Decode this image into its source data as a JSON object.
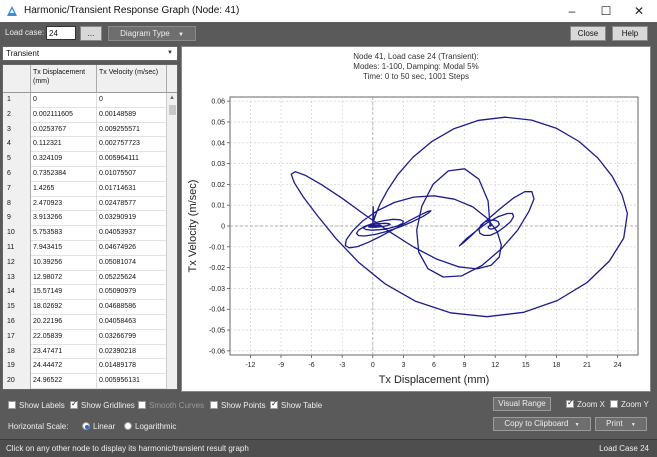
{
  "window": {
    "title": "Harmonic/Transient Response Graph (Node: 41)"
  },
  "toolbar": {
    "load_case_label": "Load case:",
    "load_case_value": "24",
    "ellipsis_label": "...",
    "diagram_type_label": "Diagram Type",
    "close_label": "Close",
    "help_label": "Help"
  },
  "left": {
    "mode_select": "Transient",
    "columns": [
      "Tx Displacement (mm)",
      "Tx Velocity (m/sec)"
    ],
    "rows": [
      [
        "1",
        "0",
        "0"
      ],
      [
        "2",
        "0.002111605",
        "0.00148589"
      ],
      [
        "3",
        "0.0253767",
        "0.009255571"
      ],
      [
        "4",
        "0.112321",
        "0.002757723"
      ],
      [
        "5",
        "0.324109",
        "0.005964111"
      ],
      [
        "6",
        "0.7352384",
        "0.01075507"
      ],
      [
        "7",
        "1.4265",
        "0.01714631"
      ],
      [
        "8",
        "2.470923",
        "0.02478577"
      ],
      [
        "9",
        "3.913266",
        "0.03290919"
      ],
      [
        "10",
        "5.753583",
        "0.04053937"
      ],
      [
        "11",
        "7.943415",
        "0.04674926"
      ],
      [
        "12",
        "10.39256",
        "0.05081074"
      ],
      [
        "13",
        "12.98072",
        "0.05225624"
      ],
      [
        "14",
        "15.57149",
        "0.05090979"
      ],
      [
        "15",
        "18.02692",
        "0.04688586"
      ],
      [
        "16",
        "20.22196",
        "0.04058463"
      ],
      [
        "17",
        "22.05839",
        "0.03266799"
      ],
      [
        "18",
        "23.47471",
        "0.02390218"
      ],
      [
        "19",
        "24.44472",
        "0.01489178"
      ],
      [
        "20",
        "24.96522",
        "0.005956131"
      ]
    ]
  },
  "chart_data": {
    "type": "line",
    "title_lines": [
      "Node 41, Load case 24 (Transient):",
      "Modes: 1-100, Damping: Modal 5%",
      "Time: 0 to 50 sec, 1001 Steps"
    ],
    "xlabel": "Tx Displacement (mm)",
    "ylabel": "Tx Velocity (m/sec)",
    "xlim": [
      -14,
      26
    ],
    "ylim": [
      -0.062,
      0.062
    ],
    "xticks": [
      -12,
      -9,
      -6,
      -3,
      0,
      3,
      6,
      9,
      12,
      15,
      18,
      21,
      24
    ],
    "yticks": [
      -0.06,
      -0.05,
      -0.04,
      -0.03,
      -0.02,
      -0.01,
      0,
      0.01,
      0.02,
      0.03,
      0.04,
      0.05,
      0.06
    ],
    "grid": true,
    "series": [
      {
        "color": "#1c1c8c",
        "x": [
          0,
          0.002,
          0.025,
          0.112,
          0.324,
          0.735,
          1.427,
          2.471,
          3.913,
          5.754,
          7.943,
          10.393,
          12.981,
          15.571,
          18.027,
          20.222,
          22.058,
          23.475,
          24.445,
          24.965,
          24.6,
          23.2,
          21.0,
          18.1,
          14.8,
          11.2,
          7.6,
          4.2,
          1.2,
          -1.4,
          -3.6,
          -5.4,
          -6.8,
          -7.7,
          -8.0,
          -7.6,
          -6.6,
          -5.0,
          -3.0,
          -0.8,
          1.6,
          4.0,
          6.3,
          8.4,
          10.2,
          11.6,
          12.4,
          12.6,
          12.2,
          11.2,
          9.8,
          8.0,
          6.0,
          4.0,
          2.1,
          0.4,
          -1.0,
          -2.0,
          -2.6,
          -2.7,
          -2.3,
          -1.5,
          -0.4,
          0.9,
          2.3,
          3.6,
          4.7,
          5.4,
          5.7,
          5.5,
          4.9,
          3.9,
          2.7,
          1.4,
          0.2,
          -0.8,
          -1.4,
          -1.6,
          -1.4,
          -0.8,
          0.1,
          1.1,
          2.0,
          2.7,
          3.0,
          2.9,
          2.4,
          1.6,
          0.7,
          -0.1,
          -0.7,
          -0.9,
          -0.7,
          -0.2,
          0.5,
          1.2,
          1.6,
          1.7,
          1.4,
          0.9,
          0.3,
          -0.2,
          -0.4,
          -0.3,
          0.1,
          0.5,
          0.8,
          0.8,
          0.5,
          0.2,
          0.0
        ],
        "y": [
          0,
          0.0015,
          0.0093,
          0.0028,
          0.006,
          0.0108,
          0.0171,
          0.0248,
          0.0329,
          0.0405,
          0.0467,
          0.0508,
          0.0523,
          0.0509,
          0.0469,
          0.0406,
          0.0327,
          0.0239,
          0.0149,
          0.006,
          -0.0058,
          -0.0168,
          -0.0272,
          -0.0358,
          -0.0415,
          -0.0436,
          -0.0417,
          -0.0362,
          -0.0278,
          -0.0174,
          -0.0061,
          0.0048,
          0.0139,
          0.0208,
          0.0249,
          0.0261,
          0.0243,
          0.0198,
          0.0133,
          0.0055,
          -0.0026,
          -0.0101,
          -0.016,
          -0.0196,
          -0.0206,
          -0.0189,
          -0.0149,
          -0.0092,
          -0.0027,
          0.0038,
          0.0092,
          0.0129,
          0.0145,
          0.0139,
          0.0113,
          0.0072,
          0.0024,
          -0.0025,
          -0.0066,
          -0.0094,
          -0.0105,
          -0.0099,
          -0.0078,
          -0.0046,
          -0.0009,
          0.0026,
          0.0054,
          0.007,
          0.0073,
          0.0064,
          0.0045,
          0.0021,
          -0.0004,
          -0.0026,
          -0.0041,
          -0.0048,
          -0.0046,
          -0.0035,
          -0.002,
          -0.0002,
          0.0014,
          0.0026,
          0.0032,
          0.003,
          0.0023,
          0.0012,
          0.0,
          -0.0011,
          -0.0018,
          -0.002,
          -0.0017,
          -0.001,
          -0.0002,
          0.0006,
          0.0011,
          0.0013,
          0.0011,
          0.0007,
          0.0002,
          -0.0003,
          -0.0006,
          -0.0006,
          -0.0004,
          -0.0001,
          0.0002,
          0.0003,
          0.0003,
          0.0001,
          0.0,
          0.0,
          0.0
        ]
      },
      {
        "color": "#1c1c8c",
        "x": [
          11.5,
          11.3,
          10.4,
          9.0,
          7.4,
          5.9,
          4.8,
          4.3,
          4.5,
          5.4,
          6.9,
          8.7,
          10.7,
          12.6,
          14.2,
          15.3,
          15.8,
          15.6,
          14.9,
          13.8,
          12.4,
          11.0,
          9.8,
          8.9,
          8.5,
          8.6,
          9.2,
          10.1,
          11.2,
          12.3,
          13.2,
          13.7,
          13.8,
          13.5,
          12.9,
          12.2,
          11.5,
          10.9,
          10.5,
          10.4,
          10.6,
          11.0,
          11.5,
          12.0,
          12.3,
          12.4,
          12.2,
          11.9,
          11.6,
          11.4,
          11.3,
          11.4,
          11.5,
          11.6,
          11.6,
          11.5,
          11.5,
          11.5
        ],
        "y": [
          0.0,
          0.012,
          0.0225,
          0.0275,
          0.0265,
          0.02,
          0.0095,
          -0.002,
          -0.0125,
          -0.0205,
          -0.0245,
          -0.024,
          -0.019,
          -0.011,
          -0.002,
          0.007,
          0.013,
          0.0165,
          0.0165,
          0.0135,
          0.008,
          0.002,
          -0.004,
          -0.008,
          -0.0095,
          -0.009,
          -0.006,
          -0.0025,
          0.0015,
          0.0045,
          0.006,
          0.006,
          0.0045,
          0.002,
          -0.0005,
          -0.003,
          -0.0045,
          -0.0045,
          -0.0035,
          -0.0015,
          0.0005,
          0.002,
          0.0028,
          0.0028,
          0.002,
          0.0008,
          -0.0004,
          -0.0012,
          -0.0015,
          -0.0012,
          -0.0006,
          0.0001,
          0.0006,
          0.0006,
          0.0003,
          0.0,
          -0.0001,
          0.0
        ]
      }
    ]
  },
  "bottom": {
    "show_labels": "Show Labels",
    "show_gridlines": "Show Gridlines",
    "smooth_curves": "Smooth Curves",
    "show_points": "Show Points",
    "show_table": "Show Table",
    "visual_range": "Visual Range",
    "zoom_x": "Zoom X",
    "zoom_y": "Zoom Y",
    "horizontal_scale": "Horizontal Scale:",
    "linear": "Linear",
    "logarithmic": "Logarithmic",
    "copy_clipboard": "Copy to Clipboard",
    "print": "Print"
  },
  "status": {
    "message": "Click on any other node to display its harmonic/transient result graph",
    "right": "Load Case 24"
  }
}
